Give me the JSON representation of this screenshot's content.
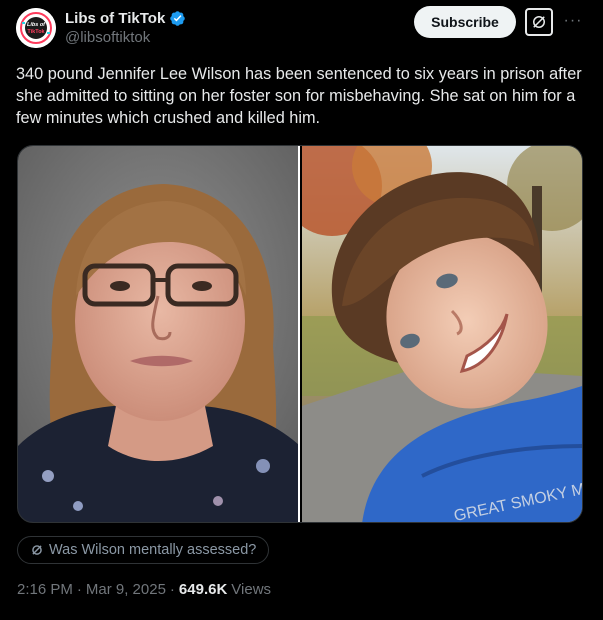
{
  "author": {
    "display_name": "Libs of TikTok",
    "handle": "@libsoftiktok",
    "avatar_icon": "libs-of-tiktok-logo",
    "avatar_text": "Libs of TikTok",
    "verified": true
  },
  "actions": {
    "subscribe_label": "Subscribe",
    "grok_icon": "grok-icon",
    "more_icon": "more-options-icon",
    "more_glyph": "···"
  },
  "post": {
    "text": "340 pound Jennifer Lee Wilson has been sentenced to six years in prison after she admitted to sitting on her foster son for misbehaving. She sat on him for a few minutes which crushed and killed him.",
    "media": [
      {
        "kind": "mugshot-photo",
        "description_icon": "woman-with-glasses-photo"
      },
      {
        "kind": "child-photo",
        "description_icon": "smiling-boy-photo",
        "shirt_text": "GREAT SMOKY MOUNTAINS"
      }
    ]
  },
  "grok_prompt": {
    "icon": "grok-icon",
    "label": "Was Wilson mentally assessed?"
  },
  "meta": {
    "time": "2:16 PM",
    "date": "Mar 9, 2025",
    "views_count": "649.6K",
    "views_label": "Views",
    "separator": "·"
  },
  "colors": {
    "background": "#000000",
    "text_primary": "#e7e9ea",
    "text_secondary": "#71767b",
    "verified_blue": "#1d9bf0",
    "border": "#2f3336"
  }
}
